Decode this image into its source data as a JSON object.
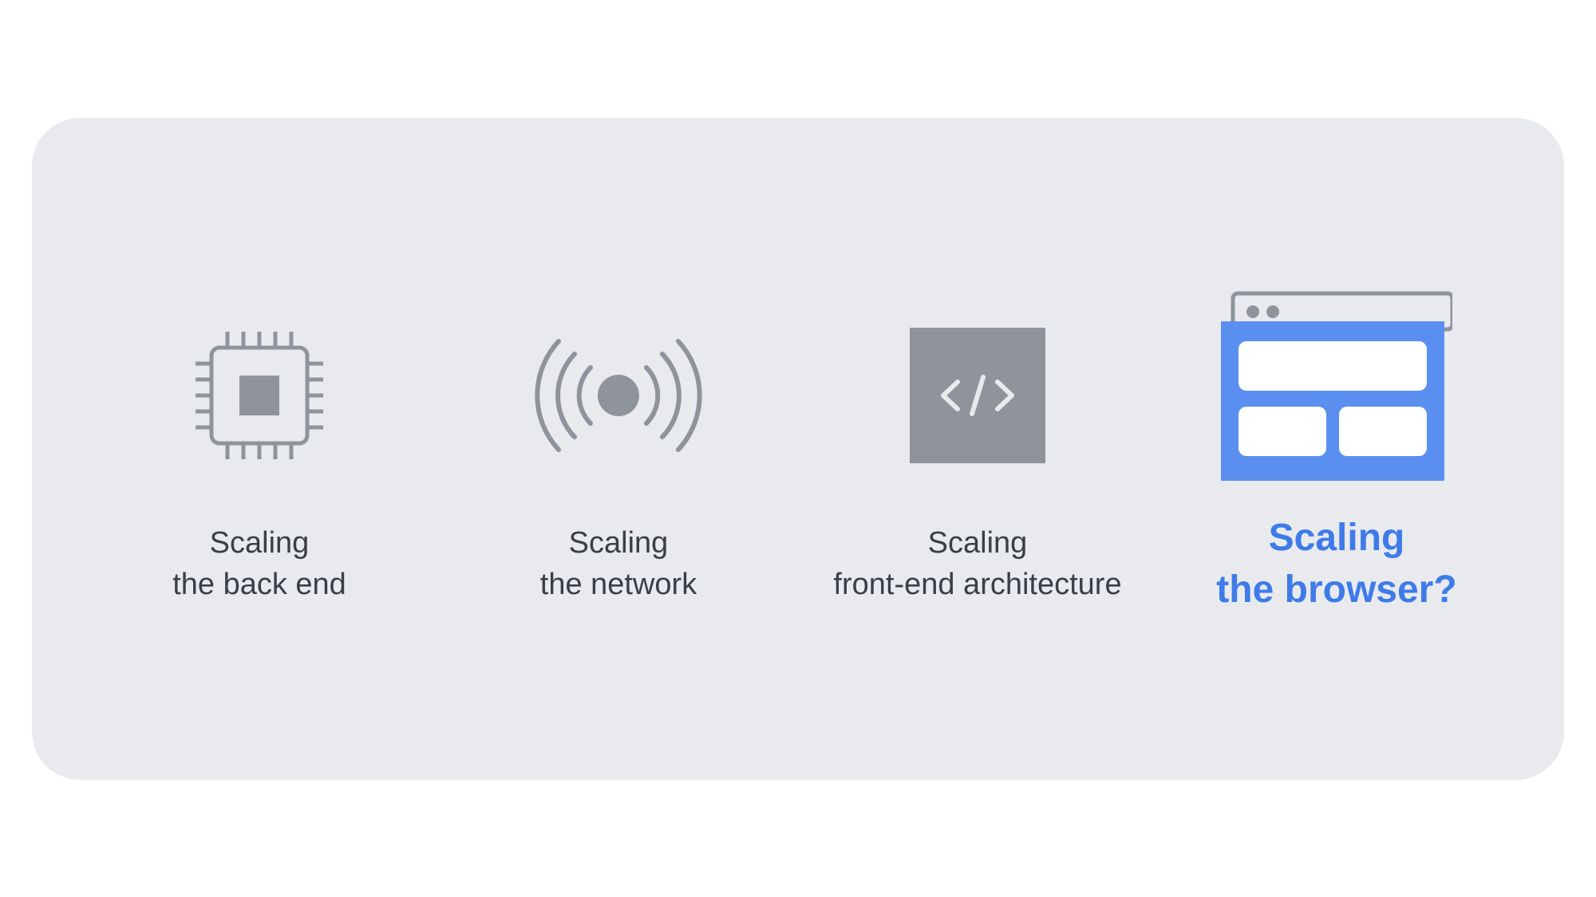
{
  "items": [
    {
      "label": "Scaling\nthe back end",
      "highlight": false,
      "icon": "cpu-icon"
    },
    {
      "label": "Scaling\nthe network",
      "highlight": false,
      "icon": "signal-icon"
    },
    {
      "label": "Scaling\nfront-end architecture",
      "highlight": false,
      "icon": "code-icon"
    },
    {
      "label": "Scaling\nthe browser?",
      "highlight": true,
      "icon": "browser-icon"
    }
  ],
  "colors": {
    "background_panel": "#e8eaee",
    "text_muted": "#3a3f47",
    "icon_muted": "#8f949c",
    "highlight": "#3f7be8"
  }
}
